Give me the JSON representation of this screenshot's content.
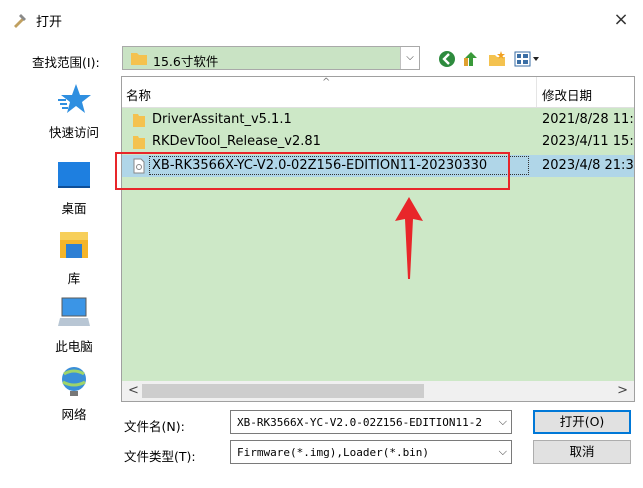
{
  "window": {
    "title": "打开",
    "close_glyph": "×"
  },
  "lookin": {
    "label": "查找范围(I):",
    "value": "15.6寸软件"
  },
  "places": [
    {
      "label": "快速访问",
      "icon": "star-icon"
    },
    {
      "label": "桌面",
      "icon": "desktop-icon"
    },
    {
      "label": "库",
      "icon": "library-icon"
    },
    {
      "label": "此电脑",
      "icon": "computer-icon"
    },
    {
      "label": "网络",
      "icon": "network-icon"
    }
  ],
  "columns": {
    "name": "名称",
    "modified": "修改日期"
  },
  "files": [
    {
      "name": "DriverAssitant_v5.1.1",
      "date": "2021/8/28 11:",
      "type": "folder"
    },
    {
      "name": "RKDevTool_Release_v2.81",
      "date": "2023/4/11 15:",
      "type": "folder"
    },
    {
      "name": "XB-RK3566X-YC-V2.0-02Z156-EDITION11-20230330",
      "date": "2023/4/8 21:3",
      "type": "file"
    }
  ],
  "filename": {
    "label": "文件名(N):",
    "value": "XB-RK3566X-YC-V2.0-02Z156-EDITION11-2"
  },
  "filetype": {
    "label": "文件类型(T):",
    "value": "Firmware(*.img),Loader(*.bin)"
  },
  "buttons": {
    "open": "打开(O)",
    "cancel": "取消"
  },
  "scroll": {
    "left": "<",
    "right": ">"
  },
  "colors": {
    "selection": "#b0d6e8",
    "list_bg": "#cde8c7",
    "annotation": "#e8262a",
    "accent": "#0078d7"
  }
}
